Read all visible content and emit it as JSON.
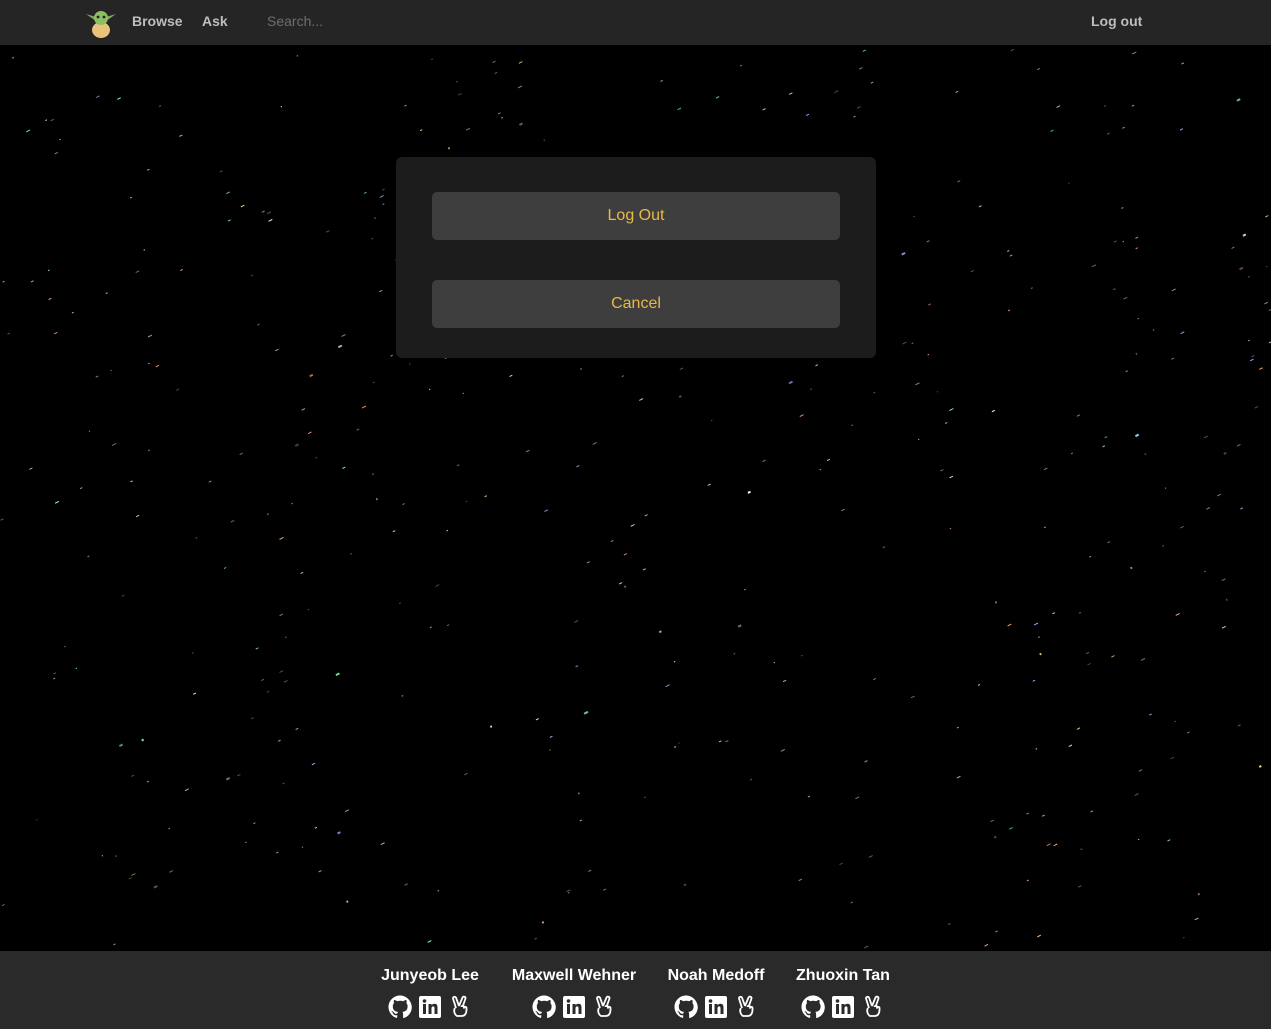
{
  "navbar": {
    "logo_icon": "baby-yoda-logo",
    "browse_label": "Browse",
    "ask_label": "Ask",
    "search_placeholder": "Search...",
    "logout_label": "Log out"
  },
  "modal": {
    "logout_button": "Log Out",
    "cancel_button": "Cancel"
  },
  "footer": {
    "members": [
      {
        "name": "Junyeob Lee",
        "icons": [
          "github-icon",
          "linkedin-icon",
          "peace-hand-icon"
        ]
      },
      {
        "name": "Maxwell Wehner",
        "icons": [
          "github-icon",
          "linkedin-icon",
          "peace-hand-icon"
        ]
      },
      {
        "name": "Noah Medoff",
        "icons": [
          "github-icon",
          "linkedin-icon",
          "peace-hand-icon"
        ]
      },
      {
        "name": "Zhuoxin Tan",
        "icons": [
          "github-icon",
          "linkedin-icon",
          "peace-hand-icon"
        ]
      }
    ]
  },
  "colors": {
    "navbar_bg": "#252525",
    "modal_bg": "#1c1c1c",
    "button_bg": "#3e3e3e",
    "button_text": "#e8b84a",
    "footer_bg": "#2a2a2a"
  }
}
